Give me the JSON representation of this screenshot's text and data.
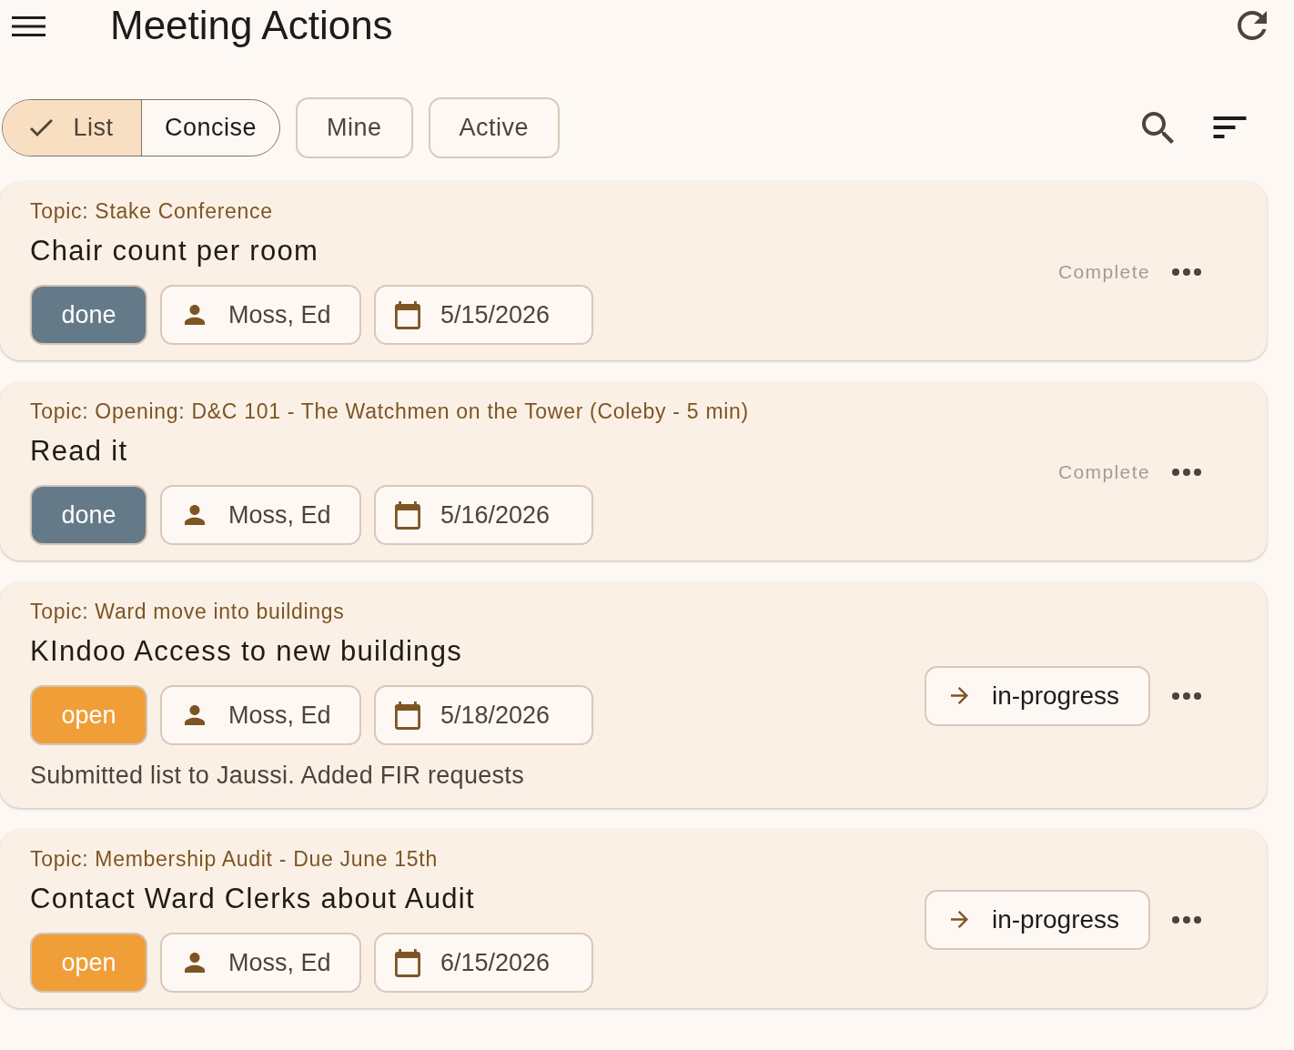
{
  "app_bar": {
    "title": "Meeting Actions"
  },
  "view_toggle": [
    {
      "label": "List",
      "selected": true
    },
    {
      "label": "Concise",
      "selected": false
    }
  ],
  "filters": [
    {
      "label": "Mine",
      "selected": false
    },
    {
      "label": "Active",
      "selected": false
    }
  ],
  "actions": [
    {
      "topic": "Topic: Stake Conference",
      "title": "Chair count per room",
      "status": {
        "label": "done",
        "color": "#657a89"
      },
      "assignee": "Moss, Ed",
      "due": "5/15/2026",
      "next_action": {
        "kind": "text",
        "label": "Complete"
      }
    },
    {
      "topic": "Topic: Opening: D&C 101 - The Watchmen on the Tower (Coleby - 5 min)",
      "title": "Read it",
      "status": {
        "label": "done",
        "color": "#657a89"
      },
      "assignee": "Moss, Ed",
      "due": "5/16/2026",
      "next_action": {
        "kind": "text",
        "label": "Complete"
      }
    },
    {
      "topic": "Topic: Ward move into buildings",
      "title": "KIndoo Access to new buildings",
      "status": {
        "label": "open",
        "color": "#f09e38"
      },
      "assignee": "Moss, Ed",
      "due": "5/18/2026",
      "notes": "Submitted list to Jaussi. Added FIR requests",
      "next_action": {
        "kind": "outlined",
        "label": "in-progress"
      }
    },
    {
      "topic": "Topic: Membership Audit - Due June 15th",
      "title": "Contact Ward Clerks about Audit",
      "status": {
        "label": "open",
        "color": "#f09e38"
      },
      "assignee": "Moss, Ed",
      "due": "6/15/2026",
      "next_action": {
        "kind": "outlined",
        "label": "in-progress"
      }
    }
  ]
}
